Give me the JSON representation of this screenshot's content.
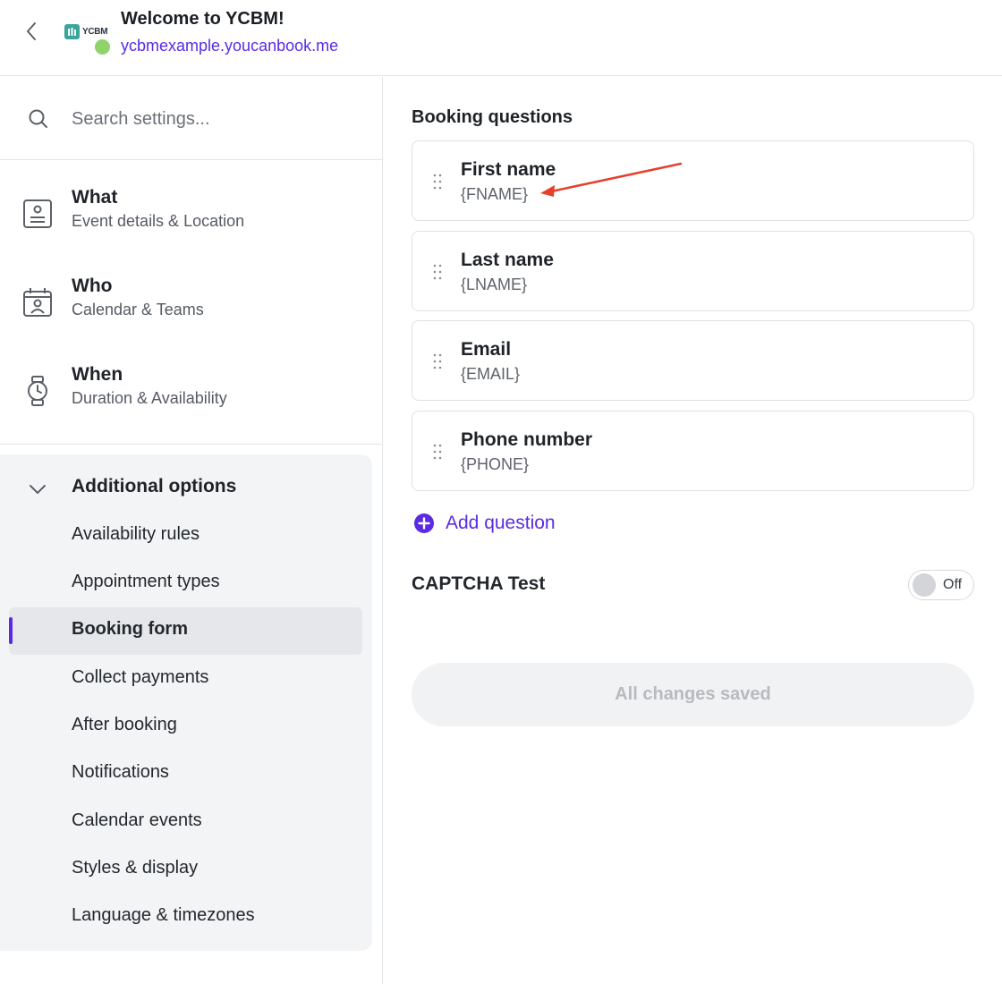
{
  "header": {
    "title": "Welcome to YCBM!",
    "link": "ycbmexample.youcanbook.me",
    "logo_text": "YCBM",
    "status_color": "#8fd36a"
  },
  "search": {
    "placeholder": "Search settings..."
  },
  "nav": [
    {
      "title": "What",
      "subtitle": "Event details & Location",
      "icon": "document-icon"
    },
    {
      "title": "Who",
      "subtitle": "Calendar & Teams",
      "icon": "calendar-person-icon"
    },
    {
      "title": "When",
      "subtitle": "Duration & Availability",
      "icon": "watch-icon"
    }
  ],
  "additional_options": {
    "title": "Additional options",
    "items": [
      "Availability rules",
      "Appointment types",
      "Booking form",
      "Collect payments",
      "After booking",
      "Notifications",
      "Calendar events",
      "Styles & display",
      "Language & timezones"
    ],
    "active": "Booking form"
  },
  "main": {
    "section_title": "Booking questions",
    "questions": [
      {
        "label": "First name",
        "token": "{FNAME}"
      },
      {
        "label": "Last name",
        "token": "{LNAME}"
      },
      {
        "label": "Email",
        "token": "{EMAIL}"
      },
      {
        "label": "Phone number",
        "token": "{PHONE}"
      }
    ],
    "add_question": "Add question",
    "captcha": {
      "label": "CAPTCHA Test",
      "state": "Off"
    },
    "save_label": "All changes saved"
  },
  "colors": {
    "accent": "#5a2be3",
    "annotation": "#e4412c"
  }
}
